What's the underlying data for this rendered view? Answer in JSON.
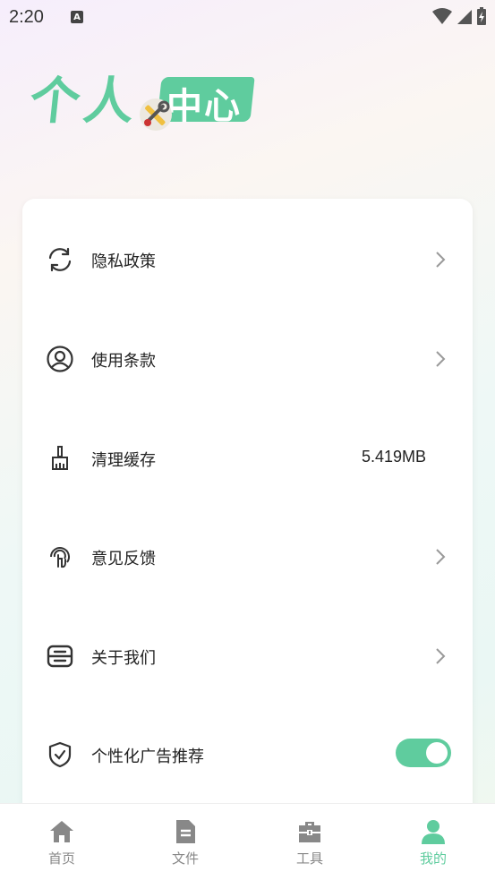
{
  "status_bar": {
    "time": "2:20",
    "notification_icon": "A"
  },
  "hero": {
    "title_part1": "个人",
    "title_part2": "中心"
  },
  "menu": {
    "items": [
      {
        "label": "隐私政策",
        "icon": "sync-icon",
        "has_chevron": true
      },
      {
        "label": "使用条款",
        "icon": "user-circle-icon",
        "has_chevron": true
      },
      {
        "label": "清理缓存",
        "icon": "brush-icon",
        "value": "5.419MB"
      },
      {
        "label": "意见反馈",
        "icon": "touch-icon",
        "has_chevron": true
      },
      {
        "label": "关于我们",
        "icon": "info-box-icon",
        "has_chevron": true
      },
      {
        "label": "个性化广告推荐",
        "icon": "shield-check-icon",
        "toggle_on": true
      }
    ]
  },
  "tabbar": {
    "tabs": [
      {
        "label": "首页",
        "icon": "home-icon",
        "active": false
      },
      {
        "label": "文件",
        "icon": "file-icon",
        "active": false
      },
      {
        "label": "工具",
        "icon": "toolbox-icon",
        "active": false
      },
      {
        "label": "我的",
        "icon": "person-icon",
        "active": true
      }
    ]
  },
  "colors": {
    "accent": "#5fcc9e",
    "inactive": "#888888"
  }
}
